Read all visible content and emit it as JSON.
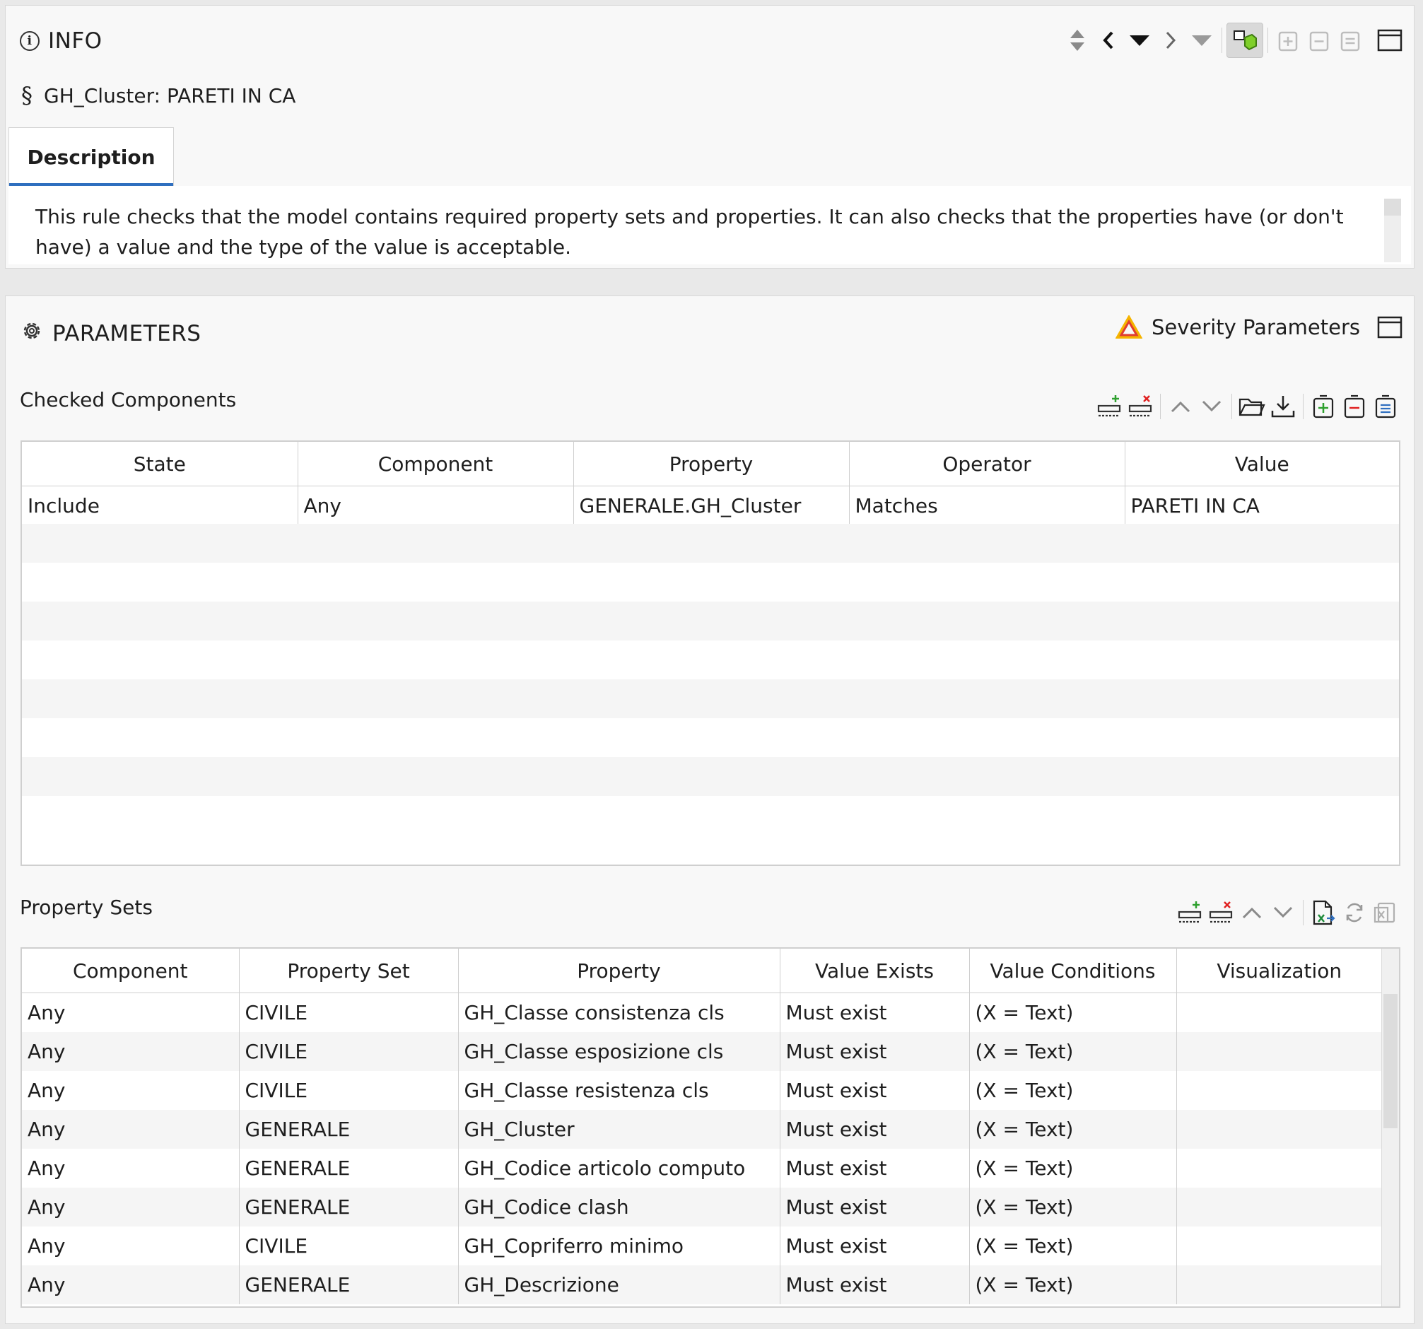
{
  "info": {
    "title": "INFO",
    "rule_title": "GH_Cluster: PARETI IN CA",
    "tab_label": "Description",
    "description": "This rule checks that the model contains required property sets and properties. It can also checks that the properties have (or don't have) a value and the type of the value is acceptable."
  },
  "parameters": {
    "title": "PARAMETERS",
    "severity_label": "Severity Parameters",
    "checked_components": {
      "label": "Checked Components",
      "columns": [
        "State",
        "Component",
        "Property",
        "Operator",
        "Value"
      ],
      "rows": [
        [
          "Include",
          "Any",
          "GENERALE.GH_Cluster",
          "Matches",
          "PARETI IN CA"
        ]
      ]
    },
    "property_sets": {
      "label": "Property Sets",
      "columns": [
        "Component",
        "Property Set",
        "Property",
        "Value Exists",
        "Value Conditions",
        "Visualization"
      ],
      "rows": [
        [
          "Any",
          "CIVILE",
          "GH_Classe consistenza cls",
          "Must exist",
          "(X = Text)",
          ""
        ],
        [
          "Any",
          "CIVILE",
          "GH_Classe esposizione cls",
          "Must exist",
          "(X = Text)",
          ""
        ],
        [
          "Any",
          "CIVILE",
          "GH_Classe resistenza cls",
          "Must exist",
          "(X = Text)",
          ""
        ],
        [
          "Any",
          "GENERALE",
          "GH_Cluster",
          "Must exist",
          "(X = Text)",
          ""
        ],
        [
          "Any",
          "GENERALE",
          "GH_Codice articolo computo",
          "Must exist",
          "(X = Text)",
          ""
        ],
        [
          "Any",
          "GENERALE",
          "GH_Codice clash",
          "Must exist",
          "(X = Text)",
          ""
        ],
        [
          "Any",
          "CIVILE",
          "GH_Copriferro minimo",
          "Must exist",
          "(X = Text)",
          ""
        ],
        [
          "Any",
          "GENERALE",
          "GH_Descrizione",
          "Must exist",
          "(X = Text)",
          ""
        ]
      ]
    }
  },
  "colors": {
    "accent": "#2f6fbf",
    "panel_bg": "#f8f8f8",
    "row_alt": "#f5f5f5",
    "severity_triangle_outer": "#f5b400",
    "severity_triangle_inner": "#e03c31"
  }
}
